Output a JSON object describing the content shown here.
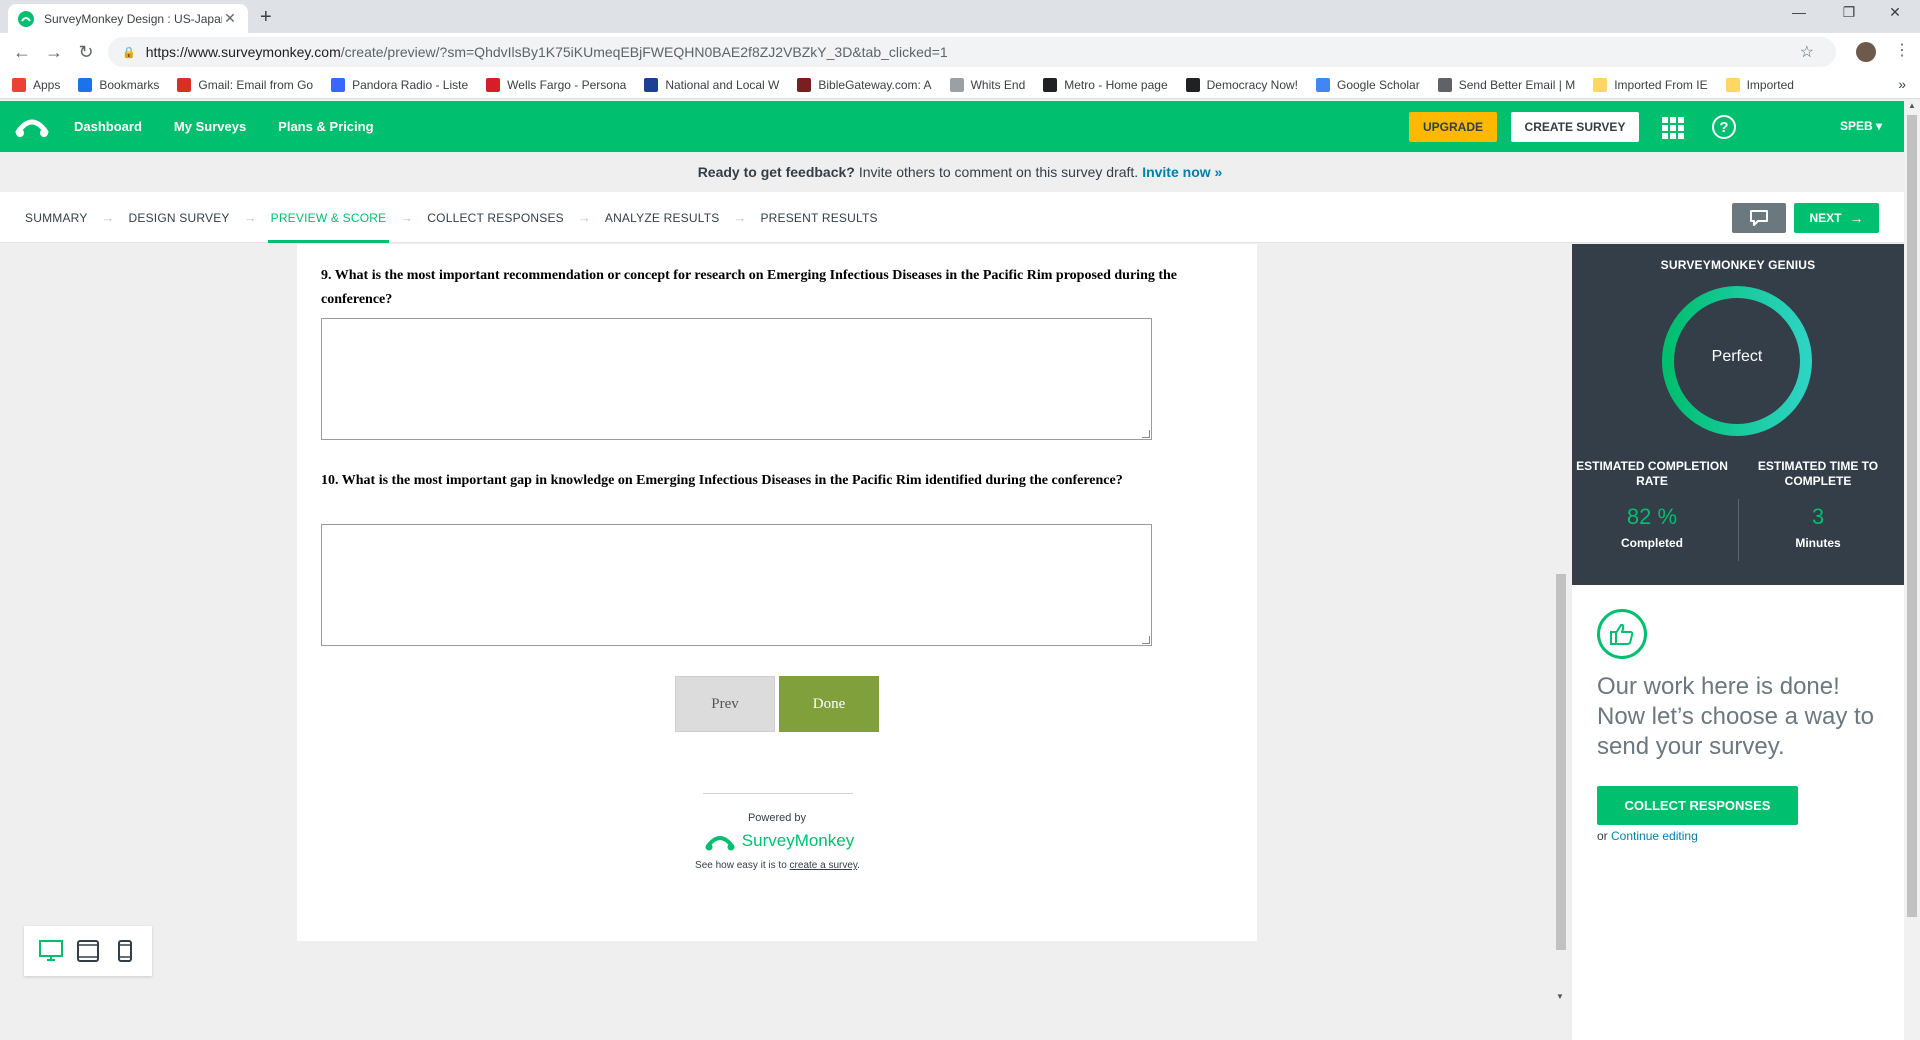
{
  "browser": {
    "tab_title": "SurveyMonkey Design : US-Japan",
    "tab_close": "✕",
    "new_tab": "+",
    "url_host": "https://www.surveymonkey.com",
    "url_rest": "/create/preview/?sm=QhdvIlsBy1K75iKUmeqEBjFWEQHN0BAE2f8ZJ2VBZkY_3D&tab_clicked=1",
    "window_controls": [
      "—",
      "❐",
      "✕"
    ],
    "bookmarks": [
      {
        "label": "Apps",
        "color": "#ea4335"
      },
      {
        "label": "Bookmarks",
        "color": "#1a73e8"
      },
      {
        "label": "Gmail: Email from Go",
        "color": "#d93025"
      },
      {
        "label": "Pandora Radio - Liste",
        "color": "#3668ff"
      },
      {
        "label": "Wells Fargo - Persona",
        "color": "#d71e28"
      },
      {
        "label": "National and Local W",
        "color": "#1c3f94"
      },
      {
        "label": "BibleGateway.com: A",
        "color": "#7a1f1f"
      },
      {
        "label": "Whits End",
        "color": "#9aa0a6"
      },
      {
        "label": "Metro - Home page",
        "color": "#202124"
      },
      {
        "label": "Democracy Now!",
        "color": "#202124"
      },
      {
        "label": "Google Scholar",
        "color": "#4285f4"
      },
      {
        "label": "Send Better Email | M",
        "color": "#5f6368"
      },
      {
        "label": "Imported From IE",
        "color": "#fdd663"
      },
      {
        "label": "Imported",
        "color": "#fdd663"
      }
    ],
    "bookmarks_more": "»"
  },
  "header": {
    "nav": [
      "Dashboard",
      "My Surveys",
      "Plans & Pricing"
    ],
    "upgrade": "UPGRADE",
    "create_survey": "CREATE SURVEY",
    "help": "?",
    "user": "SPEB ▾",
    "brand_color": "#00bf6f"
  },
  "banner": {
    "bold": "Ready to get feedback?",
    "text": "Invite others to comment on this survey draft.",
    "link": "Invite now »"
  },
  "steps": [
    {
      "label": "SUMMARY",
      "active": false
    },
    {
      "label": "DESIGN SURVEY",
      "active": false
    },
    {
      "label": "PREVIEW & SCORE",
      "active": true
    },
    {
      "label": "COLLECT RESPONSES",
      "active": false
    },
    {
      "label": "ANALYZE RESULTS",
      "active": false
    },
    {
      "label": "PRESENT RESULTS",
      "active": false
    }
  ],
  "step_arrow": "→",
  "next_button": "NEXT",
  "survey": {
    "questions": [
      {
        "text": "9. What is the most important recommendation or concept for research on Emerging Infectious Diseases in the Pacific Rim proposed during the conference?"
      },
      {
        "text": "10. What is the most important gap in knowledge on Emerging Infectious Diseases in the Pacific Rim identified during the conference?"
      }
    ],
    "prev": "Prev",
    "done": "Done",
    "powered_by": "Powered by",
    "brand": "SurveyMonkey",
    "see_how_prefix": "See how easy it is to ",
    "see_how_link": "create a survey",
    "see_how_suffix": "."
  },
  "genius": {
    "title": "SURVEYMONKEY GENIUS",
    "rating": "Perfect",
    "completion_label": "ESTIMATED COMPLETION RATE",
    "completion_value": "82 %",
    "completion_unit": "Completed",
    "completion_rate": 0.82,
    "time_label": "ESTIMATED TIME TO COMPLETE",
    "time_value": "3",
    "time_unit": "Minutes"
  },
  "sidepanel": {
    "message": "Our work here is done! Now let’s choose a way to send your survey.",
    "collect_button": "COLLECT RESPONSES",
    "or": "or ",
    "continue_link": "Continue editing"
  }
}
